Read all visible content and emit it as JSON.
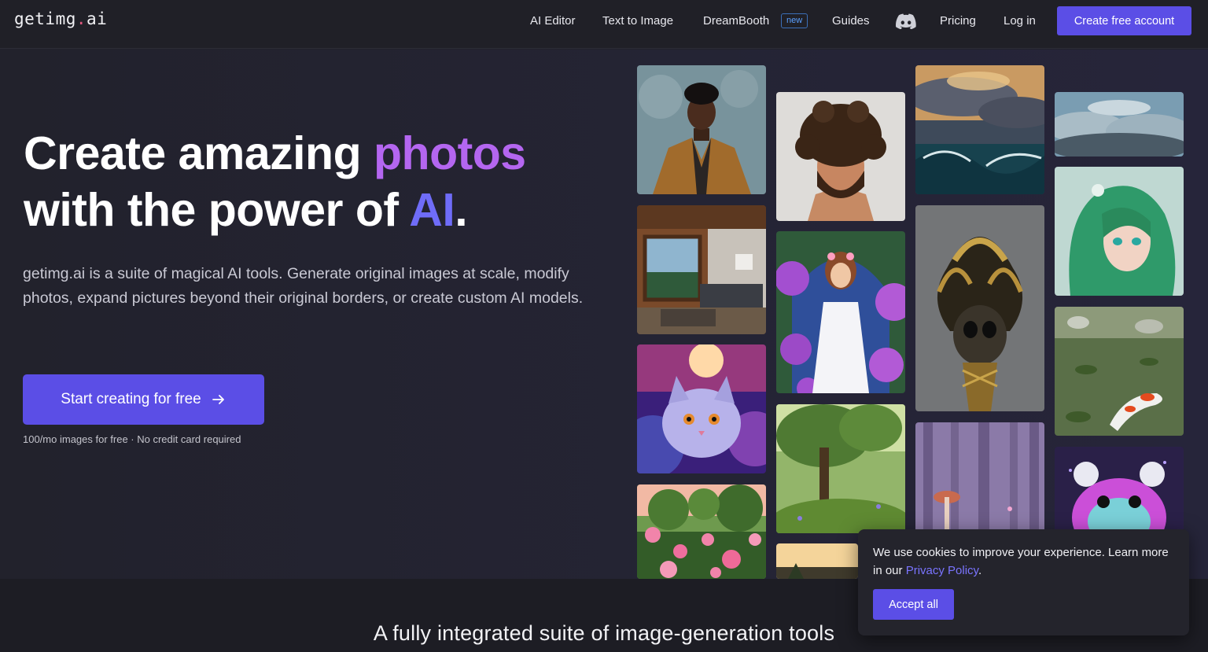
{
  "brand": {
    "logo_main": "getimg",
    "logo_dot": ".",
    "logo_tld": "ai"
  },
  "nav": {
    "links": [
      "AI Editor",
      "Text to Image",
      "DreamBooth",
      "Guides",
      "Pricing",
      "Log in"
    ],
    "new_badge": "new",
    "discord_icon": "discord-icon",
    "cta": "Create free account"
  },
  "hero": {
    "headline_part1": "Create amazing ",
    "headline_highlight1": "photos",
    "headline_part2": "with the power of ",
    "headline_highlight2": "AI",
    "headline_end": ".",
    "description": "getimg.ai is a suite of magical AI tools. Generate original images at scale, modify photos, expand pictures beyond their original borders, or create custom AI models.",
    "cta": "Start creating for free",
    "cta_icon": "arrow-right-icon",
    "note": "100/mo images for free · No credit card required"
  },
  "gallery": {
    "images": [
      "portrait-man-coat-image",
      "bedroom-window-image",
      "galaxy-cat-image",
      "rose-garden-image",
      "curly-hair-man-image",
      "flower-goddess-image",
      "forest-tree-image",
      "sunset-landscape-image",
      "stormy-sea-image",
      "golden-skull-image",
      "misty-forest-mushroom-image",
      "clouds-image",
      "green-hair-anime-image",
      "koi-pond-image",
      "purple-hamster-image"
    ]
  },
  "section2": {
    "title": "A fully integrated suite of image-generation tools"
  },
  "cookie": {
    "text": "We use cookies to improve your experience. Learn more in our ",
    "link": "Privacy Policy",
    "end": ".",
    "button": "Accept all"
  },
  "colors": {
    "accent": "#5b4ee6",
    "highlight_purple": "#b466f0",
    "highlight_blue": "#6f6cf8",
    "background": "#22222c"
  }
}
